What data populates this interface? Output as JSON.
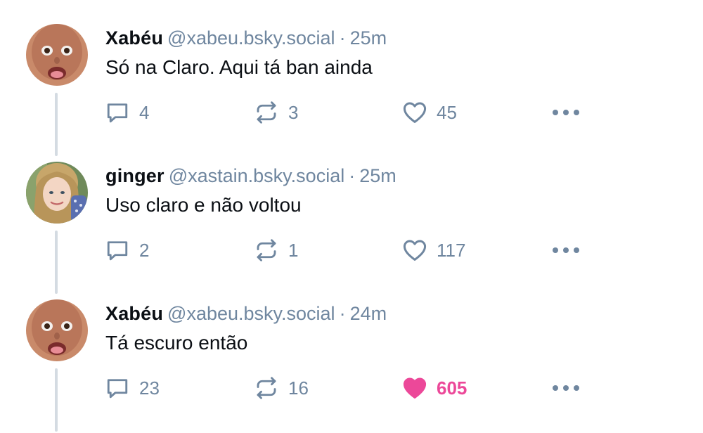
{
  "colors": {
    "text": "#0b0f14",
    "muted": "#6f869f",
    "thread_line": "#d4dbe2",
    "like_active": "#ec4899"
  },
  "icons": {
    "reply": "speech-bubble-icon",
    "repost": "repost-arrows-icon",
    "like": "heart-icon",
    "more": "ellipsis-icon"
  },
  "posts": [
    {
      "author": "Xabéu",
      "handle": "@xabeu.bsky.social",
      "separator": "·",
      "time": "25m",
      "text": "Só na Claro. Aqui tá ban ainda",
      "replies": "4",
      "reposts": "3",
      "likes": "45",
      "liked": false
    },
    {
      "author": "ginger",
      "handle": "@xastain.bsky.social",
      "separator": "·",
      "time": "25m",
      "text": "Uso claro e não voltou",
      "replies": "2",
      "reposts": "1",
      "likes": "117",
      "liked": false
    },
    {
      "author": "Xabéu",
      "handle": "@xabeu.bsky.social",
      "separator": "·",
      "time": "24m",
      "text": "Tá escuro então",
      "replies": "23",
      "reposts": "16",
      "likes": "605",
      "liked": true
    }
  ]
}
